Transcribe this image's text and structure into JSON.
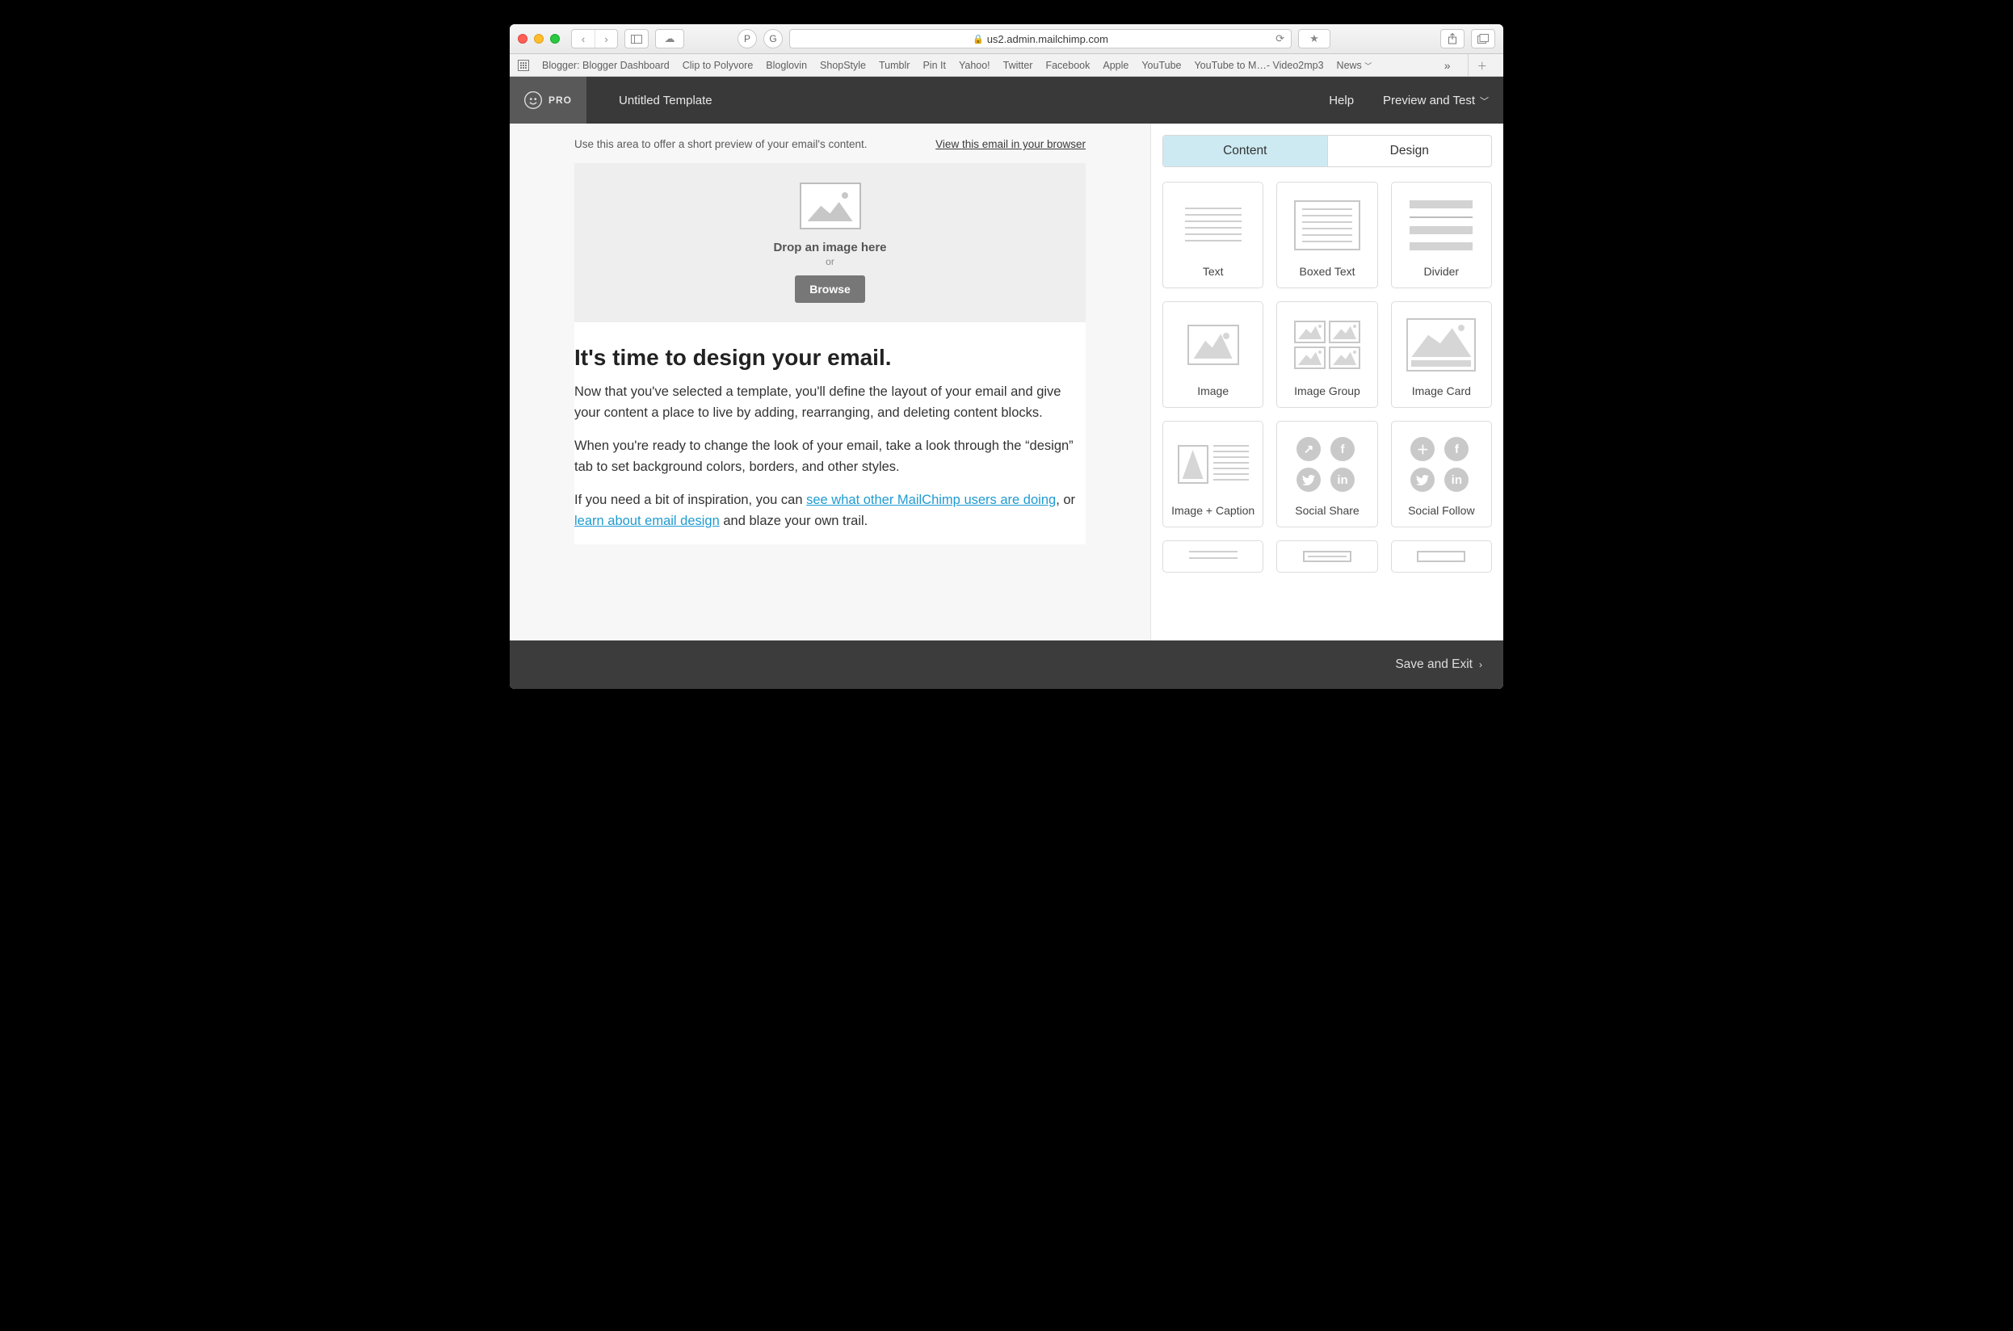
{
  "browser": {
    "address_domain": "us2.admin.mailchimp.com",
    "bookmarks": [
      "Blogger: Blogger Dashboard",
      "Clip to Polyvore",
      "Bloglovin",
      "ShopStyle",
      "Tumblr",
      "Pin It",
      "Yahoo!",
      "Twitter",
      "Facebook",
      "Apple",
      "YouTube",
      "YouTube to M…- Video2mp3",
      "News"
    ]
  },
  "app": {
    "brand": "PRO",
    "template_title": "Untitled Template",
    "help": "Help",
    "preview_test": "Preview and Test"
  },
  "preview": {
    "hint": "Use this area to offer a short preview of your email's content.",
    "view_link": "View this email in your browser"
  },
  "dropzone": {
    "title": "Drop an image here",
    "or": "or",
    "browse": "Browse"
  },
  "editor": {
    "heading": "It's time to design your email.",
    "p1": "Now that you've selected a template, you'll define the layout of your email and give your content a place to live by adding, rearranging, and deleting content blocks.",
    "p2": "When you're ready to change the look of your email, take a look through the “design” tab to set background colors, borders, and other styles.",
    "p3_a": "If you need a bit of inspiration, you can ",
    "p3_link1": "see what other MailChimp users are doing",
    "p3_b": ", or ",
    "p3_link2": "learn about email design",
    "p3_c": " and blaze your own trail."
  },
  "tabs": {
    "content": "Content",
    "design": "Design"
  },
  "blocks": [
    "Text",
    "Boxed Text",
    "Divider",
    "Image",
    "Image Group",
    "Image Card",
    "Image + Caption",
    "Social Share",
    "Social Follow"
  ],
  "footer": {
    "save_exit": "Save and Exit"
  }
}
